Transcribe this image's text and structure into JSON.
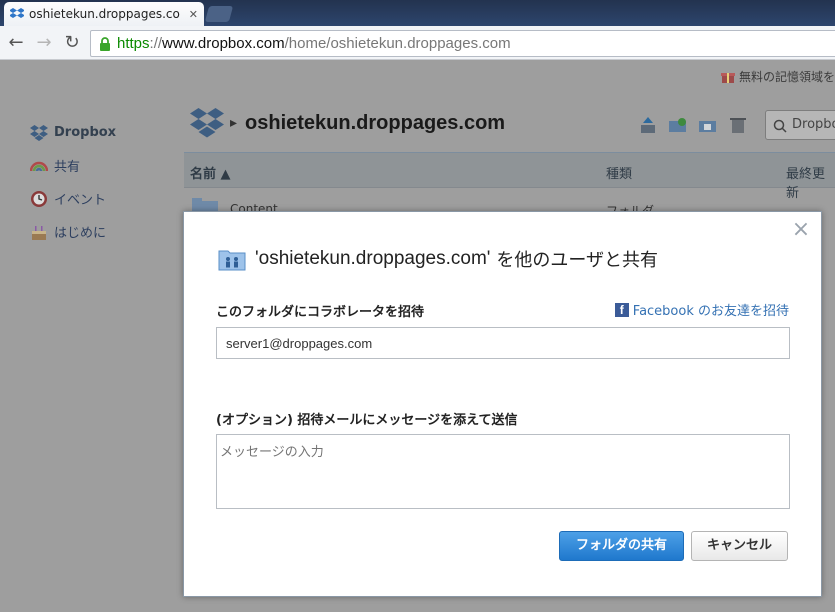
{
  "browser": {
    "tab_title": "oshietekun.droppages.co",
    "url_scheme": "https",
    "url_sep": "://",
    "url_host": "www.dropbox.com",
    "url_path": "/home/oshietekun.droppages.com"
  },
  "page": {
    "top_link": "無料の記憶領域を",
    "sidebar": [
      {
        "label": "Dropbox"
      },
      {
        "label": "共有"
      },
      {
        "label": "イベント"
      },
      {
        "label": "はじめに"
      }
    ],
    "folder_title": "oshietekun.droppages.com",
    "search_placeholder": "Dropbo",
    "table_headers": {
      "name": "名前 ▲",
      "kind": "種類",
      "modified": "最終更新"
    },
    "rows": [
      {
        "name": "Content",
        "kind": "フォルダ"
      }
    ]
  },
  "modal": {
    "title_quoted": "'oshietekun.droppages.com'",
    "title_rest": "を他のユーザと共有",
    "invite_label": "このフォルダにコラボレータを招待",
    "facebook_link": "Facebook のお友達を招待",
    "invite_value": "server1@droppages.com",
    "message_label": "(オプション) 招待メールにメッセージを添えて送信",
    "message_placeholder": "メッセージの入力",
    "share_button": "フォルダの共有",
    "cancel_button": "キャンセル",
    "close_glyph": "×"
  },
  "colors": {
    "primary_button": "#2b86d6",
    "https_green": "#0b8a00",
    "link_blue": "#3471b3"
  }
}
